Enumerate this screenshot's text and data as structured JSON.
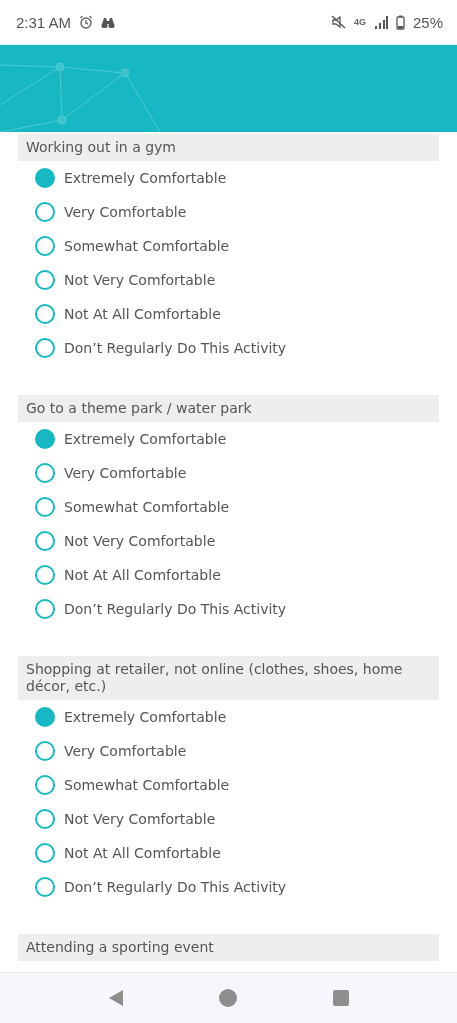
{
  "status_bar": {
    "time": "2:31 AM",
    "network": "4G",
    "battery": "25%"
  },
  "questions": [
    {
      "title": "Working out in a gym",
      "options": [
        {
          "label": "Extremely Comfortable",
          "selected": true
        },
        {
          "label": "Very Comfortable",
          "selected": false
        },
        {
          "label": "Somewhat Comfortable",
          "selected": false
        },
        {
          "label": "Not Very Comfortable",
          "selected": false
        },
        {
          "label": "Not At All Comfortable",
          "selected": false
        },
        {
          "label": "Don’t Regularly Do This Activity",
          "selected": false
        }
      ]
    },
    {
      "title": "Go to a theme park / water park",
      "options": [
        {
          "label": "Extremely Comfortable",
          "selected": true
        },
        {
          "label": "Very Comfortable",
          "selected": false
        },
        {
          "label": "Somewhat Comfortable",
          "selected": false
        },
        {
          "label": "Not Very Comfortable",
          "selected": false
        },
        {
          "label": "Not At All Comfortable",
          "selected": false
        },
        {
          "label": "Don’t Regularly Do This Activity",
          "selected": false
        }
      ]
    },
    {
      "title": "Shopping at retailer, not online (clothes, shoes, home décor, etc.)",
      "options": [
        {
          "label": "Extremely Comfortable",
          "selected": true
        },
        {
          "label": "Very Comfortable",
          "selected": false
        },
        {
          "label": "Somewhat Comfortable",
          "selected": false
        },
        {
          "label": "Not Very Comfortable",
          "selected": false
        },
        {
          "label": "Not At All Comfortable",
          "selected": false
        },
        {
          "label": "Don’t Regularly Do This Activity",
          "selected": false
        }
      ]
    },
    {
      "title": "Attending a sporting event"
    }
  ]
}
